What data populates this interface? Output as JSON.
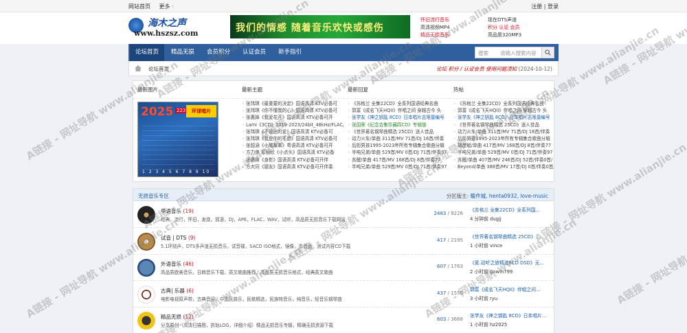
{
  "topbar": {
    "left_links": [
      "网站首页",
      "更多 ·"
    ],
    "right_links": [
      "注册",
      "登录"
    ]
  },
  "logo": {
    "line1": "海木之声",
    "line2": "www.hszsz.com"
  },
  "banner": {
    "text": "我们的情感 随着音乐欢快或感伤"
  },
  "header_links": [
    {
      "a": "怀旧流行音乐",
      "b": "现在DTS声道"
    },
    {
      "a": "高清视频MP4",
      "b": "积分 认证 会员"
    },
    {
      "a": "精品无损音乐",
      "b": "高品质320MP3"
    }
  ],
  "nav": {
    "items": [
      "论坛首页",
      "精品无损",
      "会员积分",
      "认证会员",
      "新手指引"
    ],
    "search_select": "搜索",
    "search_placeholder": "请输入搜索内容"
  },
  "breadcrumb": {
    "path": "论坛首页",
    "right_text": "论坛 积分 / 认证会员 使用问题须知",
    "date": "(2024-10-12)"
  },
  "latest": {
    "col_titles": [
      "最新图片",
      "最新主题",
      "最新回复",
      "热帖"
    ],
    "poster": {
      "year": "2025",
      "tag": "223",
      "box": "环球唱片",
      "pages": "1 2 3 4 5 6 7 8 9 10"
    },
    "topics": [
      "张玮琪《最重要的决定》国语高清 KTV必备可",
      "张玮琪《你不懂我的心》国语高清 KTV必备可",
      "张惠妹《我爱花开》国语高清 KTV必备可开",
      "Lami《3CD》2019-2023/24bit_48kHz/FLAC/CT",
      "张玮琪《不说出的爱》国语高清 KTV必备可",
      "张玮琪《我是你的不想》国语高清 KTV必备可",
      "张韶涵《小城故事》粤语高清 KTV必备可开",
      "方力申 邓丽欣《小点头》国语高清 KTV必备",
      "张惠妹《身影》国语高清 KTV必备可开伴",
      "方大同《朋友》国语高清 KTV必备可开伴奏"
    ],
    "replies": [
      {
        "t": "《苏格兰 全集22CD》全系列国语经典名曲",
        "c": ""
      },
      {
        "t": "郭富《成名飞天HQII》伴唱之间 穿越古今 头",
        "c": ""
      },
      {
        "t": "张学友《神之钥匙 8CD》日本唱片志限量编号",
        "c": "blue"
      },
      {
        "t": "张国荣《纪念合集珍藏四CD》专辑版",
        "c": "green"
      },
      {
        "t": "《世界著名钢琴曲精选 25CD》送人佳品",
        "c": ""
      },
      {
        "t": "动力火车/单曲 311首/MV 71首/DJ 16首/伴奏",
        "c": ""
      },
      {
        "t": "后街男孩1995-2023年所有专辑集合歌曲分辑",
        "c": ""
      },
      {
        "t": "半吨兄弟/单曲 529首/MV 0首/DJ 71首/伴奏97",
        "c": ""
      },
      {
        "t": "苏醒/单曲 417首/MV 168首/DJ 8首/伴奏77",
        "c": ""
      },
      {
        "t": "半吨兄弟/单曲 529首/MV 0首/DJ 71首/伴奏97",
        "c": ""
      }
    ],
    "hot": [
      {
        "t": "《苏格兰 全集22CD》全系列国语经典名曲",
        "c": ""
      },
      {
        "t": "郭富《成名飞天HQII》伴唱之间 穿越古今 头",
        "c": ""
      },
      {
        "t": "张学友《神之钥匙 8CD》日本唱片志限量编号",
        "c": "blue"
      },
      {
        "t": "《世界著名钢琴曲精选 25CD》送人佳品",
        "c": ""
      },
      {
        "t": "动力火车/单曲 311首/MV 71首/DJ 16首/伴奏",
        "c": ""
      },
      {
        "t": "后街男孩1995-2023年所有专辑集合歌曲分辑",
        "c": ""
      },
      {
        "t": "胡彦斌/单曲 417首/MV 168首/DJ 8首/伴奏77",
        "c": ""
      },
      {
        "t": "半吨兄弟/单曲 529首/MV 0首/DJ 71首/伴奏97",
        "c": ""
      },
      {
        "t": "苏醒/单曲 407首/MV 246首/DJ 52首/伴奏0首/",
        "c": ""
      },
      {
        "t": "Beyond/单曲 388首/MV 17首/DJ 0首/伴奏0首/专辑",
        "c": ""
      }
    ]
  },
  "forum": {
    "title": "无损音乐专区",
    "mods_label": "分区版主:",
    "mods": "暖件城, henta0932, love-music",
    "rows": [
      {
        "name": "华语音乐",
        "count": "(19)",
        "desc": "经典，流行，怀旧，发烧，摇滚，DJ，APE，FLAC，WAV，试听，高品质无损音乐下载网站",
        "threads": "2483",
        "posts": "9226",
        "last_title": "《苏格兰 全集22CD》全系列国...",
        "last_by": "4 分钟前 dugjj",
        "ic": "vinyl"
      },
      {
        "name": "试音 | DTS",
        "count": "(9)",
        "desc": "5.1环绕声，DTS多声道无损音乐，试音碟，SACD ISO格式，镜像，条音品，测试内容CD下载",
        "threads": "417",
        "posts": "2195",
        "last_title": "《世界著名钢琴曲精选 25CD》...",
        "last_by": "1 小时前 vince",
        "ic": "cd"
      },
      {
        "name": "外语音乐",
        "count": "(46)",
        "desc": "高品质欧美音乐，日韩音乐下载，英文歌曲推荐，高品质无损音乐格式，经典英文歌曲",
        "threads": "607",
        "posts": "1763",
        "last_title": "《爱.动听之旅精选8CD DSD》无...",
        "last_by": "2 小时前 gowin799",
        "ic": "play"
      },
      {
        "name": "古典| 乐器",
        "count": "(6)",
        "desc": "电影电视原声带，古典音乐，中国民族乐，民歌精选，民族特音乐，纯音乐，轻音乐钢琴曲",
        "threads": "437",
        "posts": "1556",
        "last_title": "郭富《成名飞天HQII》伴唱之间...",
        "last_by": "3 小时前 ryu",
        "ic": "guitar"
      },
      {
        "name": "精品无损",
        "count": "(12)",
        "desc": "分享原创（高清扫描图，抓轨LOG，详细介绍）精品无损音乐专辑，精确无损资源下载",
        "threads": "603",
        "posts": "3668",
        "last_title": "张学友《神之钥匙 8CD》日本唱片...",
        "last_by": "1 小时前 hz2025",
        "ic": "headphone"
      }
    ]
  },
  "watermark": "A链接 - 网址导航 www.alianjie.cn"
}
